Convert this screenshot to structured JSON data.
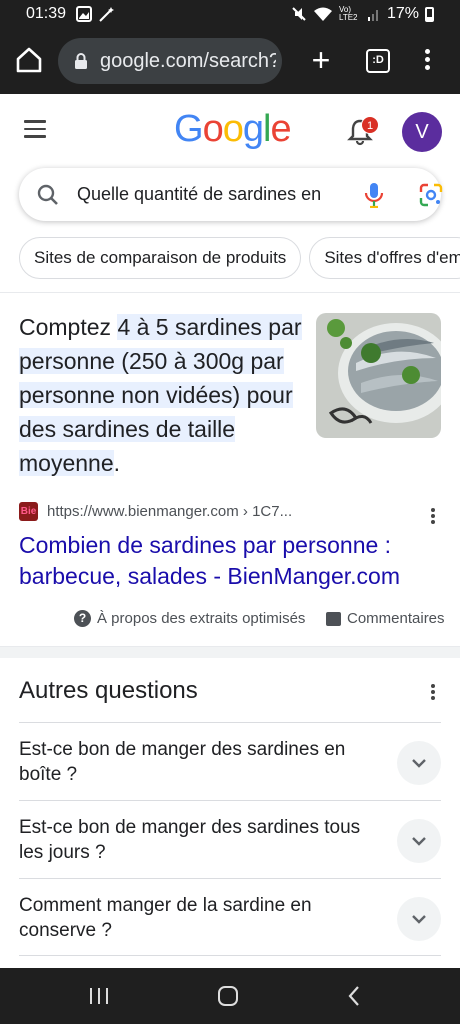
{
  "status_bar": {
    "time": "01:39",
    "network_label": "Vo) LTE2",
    "battery": "17%"
  },
  "chrome": {
    "url": "google.com/search?",
    "tab_switcher_label": ":D"
  },
  "google": {
    "logo": [
      "G",
      "o",
      "o",
      "g",
      "l",
      "e"
    ],
    "logo_colors": [
      "#4285F4",
      "#EA4335",
      "#FBBC05",
      "#4285F4",
      "#34A853",
      "#EA4335"
    ],
    "notification_count": "1",
    "avatar_initial": "V"
  },
  "search": {
    "query": "Quelle quantité de sardines en"
  },
  "chips": [
    {
      "label": "Sites de comparaison de produits"
    },
    {
      "label": "Sites d'offres d'em"
    }
  ],
  "snippet": {
    "prefix": "Comptez ",
    "highlight": "4 à 5 sardines par personne (250 à 300g par personne non vidées) pour des sardines de taille moyenne",
    "suffix": "."
  },
  "source": {
    "favicon_text": "Bie",
    "url": "https://www.bienmanger.com › 1C7...",
    "title": "Combien de sardines par personne : barbecue, salades - BienManger.com"
  },
  "footer": {
    "about_label": "À propos des extraits optimisés",
    "comments_label": "Commentaires"
  },
  "paa": {
    "title": "Autres questions",
    "questions": [
      {
        "text": "Est-ce bon de manger des sardines en boîte ?"
      },
      {
        "text": "Est-ce bon de manger des sardines tous les jours ?"
      },
      {
        "text": "Comment manger de la sardine en conserve ?"
      }
    ]
  }
}
